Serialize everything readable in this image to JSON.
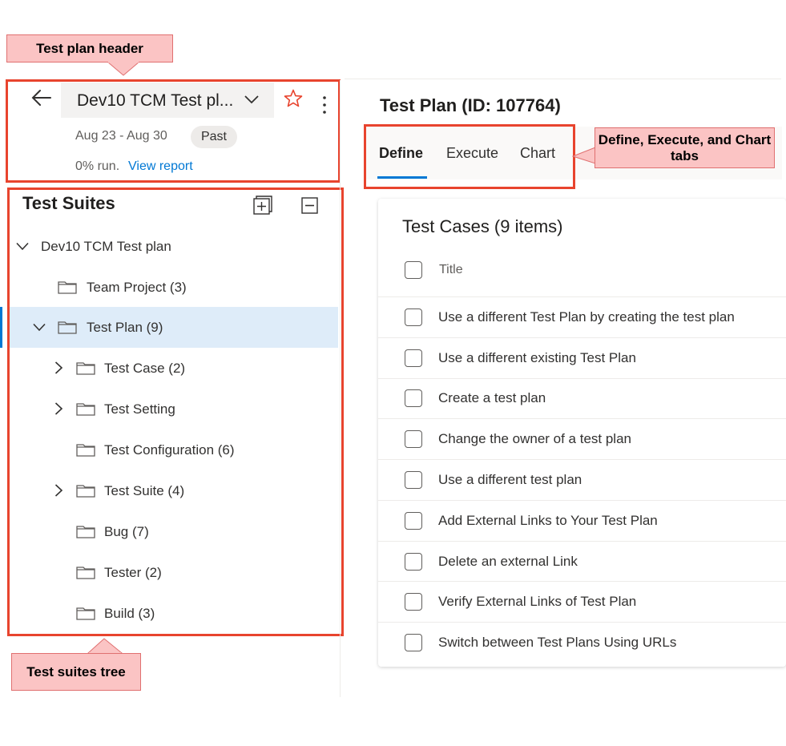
{
  "annotations": {
    "header_callout": "Test plan header",
    "tabs_callout": "Define, Execute, and Chart tabs",
    "tree_callout": "Test suites tree"
  },
  "header": {
    "plan_name": "Dev10 TCM Test pl...",
    "date_range": "Aug 23 - Aug 30",
    "status_badge": "Past",
    "run_percent": "0% run.",
    "view_report": "View report"
  },
  "page": {
    "title": "Test Plan (ID: 107764)",
    "tabs": [
      {
        "label": "Define",
        "active": true
      },
      {
        "label": "Execute",
        "active": false
      },
      {
        "label": "Chart",
        "active": false
      }
    ]
  },
  "suites": {
    "heading": "Test Suites",
    "items": [
      {
        "label": "Dev10 TCM Test plan",
        "chevron": "down"
      },
      {
        "label": "Team Project (3)",
        "chevron": "none"
      },
      {
        "label": "Test Plan (9)",
        "chevron": "down",
        "selected": true
      },
      {
        "label": "Test Case (2)",
        "chevron": "right"
      },
      {
        "label": "Test Setting",
        "chevron": "right"
      },
      {
        "label": "Test Configuration (6)",
        "chevron": "none"
      },
      {
        "label": "Test Suite (4)",
        "chevron": "right"
      },
      {
        "label": "Bug (7)",
        "chevron": "none"
      },
      {
        "label": "Tester (2)",
        "chevron": "none"
      },
      {
        "label": "Build (3)",
        "chevron": "none"
      }
    ]
  },
  "test_cases": {
    "heading": "Test Cases (9 items)",
    "column_title": "Title",
    "rows": [
      "Use a different Test Plan by creating the test plan",
      "Use a different existing Test Plan",
      "Create a test plan",
      "Change the owner of a test plan",
      "Use a different test plan",
      "Add External Links to Your Test Plan",
      "Delete an external Link",
      "Verify External Links of Test Plan",
      "Switch between Test Plans Using URLs"
    ]
  },
  "colors": {
    "accent": "#0078d4",
    "annotation_border": "#e8442e",
    "callout_fill": "#fbc4c4",
    "star": "#e8442e",
    "selected_row": "#deecf9"
  }
}
